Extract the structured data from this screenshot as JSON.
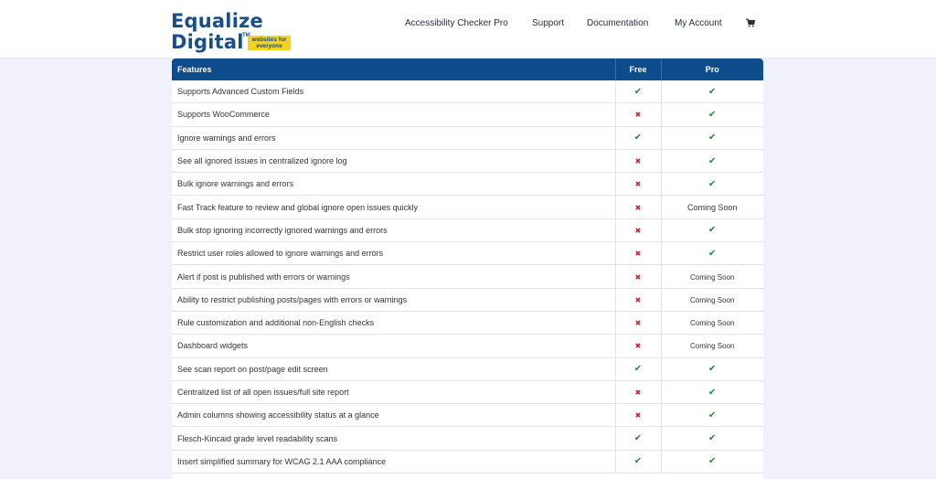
{
  "brand": {
    "line1": "Equalize",
    "line2": "Digital",
    "tm": "TM",
    "tagline": "websites for everyone"
  },
  "nav": [
    {
      "label": "Accessibility Checker Pro"
    },
    {
      "label": "Support"
    },
    {
      "label": "Documentation"
    },
    {
      "label": "My Account"
    }
  ],
  "colors": {
    "brand": "#174f8c",
    "header": "#0e4c8c",
    "check": "#1e8a2e",
    "cross": "#c0262b",
    "tag": "#f5d21b",
    "background": "#f0f1fb"
  },
  "table": {
    "headers": [
      "Features",
      "Free",
      "Pro"
    ],
    "rows": [
      {
        "feature": "Supports Advanced Custom Fields",
        "free": "yes",
        "pro": "yes"
      },
      {
        "feature": "Supports WooCommerce",
        "free": "no",
        "pro": "yes"
      },
      {
        "feature": "Ignore warnings and errors",
        "free": "yes",
        "pro": "yes"
      },
      {
        "feature": "See all ignored issues in centralized ignore log",
        "free": "no",
        "pro": "yes"
      },
      {
        "feature": "Bulk ignore warnings and errors",
        "free": "no",
        "pro": "yes"
      },
      {
        "feature": "Fast Track feature to review and global ignore open issues quickly",
        "free": "no",
        "pro": "Coming Soon"
      },
      {
        "feature": "Bulk stop ignoring incorrectly ignored warnings and errors",
        "free": "no",
        "pro": "yes"
      },
      {
        "feature": "Restrict user roles allowed to ignore warnings and errors",
        "free": "no",
        "pro": "yes"
      },
      {
        "feature": "Alert if post is published with errors or warnings",
        "free": "no",
        "pro": "Coming Soon"
      },
      {
        "feature": "Ability to restrict publishing posts/pages with errors or warnings",
        "free": "no",
        "pro": "Coming Soon"
      },
      {
        "feature": "Rule customization and additional non-English checks",
        "free": "no",
        "pro": "Coming Soon"
      },
      {
        "feature": "Dashboard widgets",
        "free": "no",
        "pro": "Coming Soon"
      },
      {
        "feature": "See scan report on post/page edit screen",
        "free": "yes",
        "pro": "yes"
      },
      {
        "feature": "Centralized list of all open issues/full site report",
        "free": "no",
        "pro": "yes"
      },
      {
        "feature": "Admin columns showing accessibility status at a glance",
        "free": "no",
        "pro": "yes"
      },
      {
        "feature": "Flesch-Kincaid grade level readability scans",
        "free": "yes",
        "pro": "yes"
      },
      {
        "feature": "Insert simplified summary for WCAG 2.1 AAA compliance",
        "free": "yes",
        "pro": "yes"
      }
    ]
  }
}
